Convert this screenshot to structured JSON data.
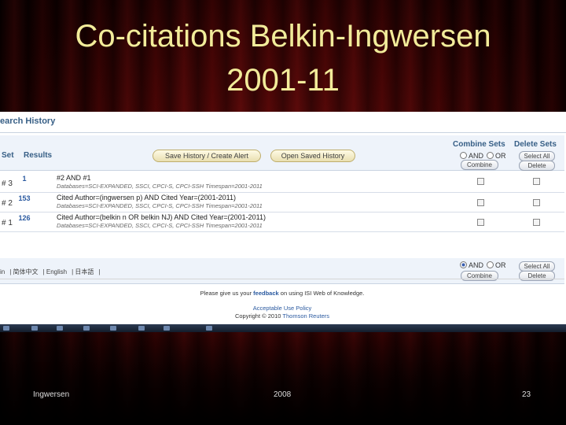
{
  "slide": {
    "title_line1": "Co-citations Belkin-Ingwersen",
    "title_line2": "2001-11",
    "footer_left": "Ingwersen",
    "footer_center": "2008",
    "footer_right": "23"
  },
  "screenshot": {
    "panel_title": "earch History",
    "columns": {
      "set": "Set",
      "results": "Results",
      "combine": "Combine Sets",
      "delete": "Delete Sets"
    },
    "buttons": {
      "save_history": "Save History / Create Alert",
      "open_saved": "Open Saved History",
      "combine": "Combine",
      "select_all": "Select All",
      "delete": "Delete"
    },
    "radio": {
      "and": "AND",
      "or": "OR"
    },
    "rows": [
      {
        "set": "# 3",
        "results": "1",
        "query": "#2 AND #1",
        "databases": "Databases=SCI-EXPANDED, SSCI, CPCI-S, CPCI-SSH Timespan=2001-2011"
      },
      {
        "set": "# 2",
        "results": "153",
        "query": "Cited Author=(ingwersen p) AND Cited Year=(2001-2011)",
        "databases": "Databases=SCI-EXPANDED, SSCI, CPCI-S, CPCI-SSH Timespan=2001-2011"
      },
      {
        "set": "# 1",
        "results": "126",
        "query": "Cited Author=(belkin n OR belkin NJ) AND Cited Year=(2001-2011)",
        "databases": "Databases=SCI-EXPANDED, SSCI, CPCI-S, CPCI-SSH Timespan=2001-2011"
      }
    ],
    "language_bar": [
      "in",
      "简体中文",
      "English",
      "日本語"
    ],
    "feedback_prefix": "Please give us your ",
    "feedback_link": "feedback",
    "feedback_suffix": " on using ISI Web of Knowledge.",
    "acceptable_use": "Acceptable Use Policy",
    "copyright_prefix": "Copyright © 2010 ",
    "copyright_owner": "Thomson Reuters"
  }
}
